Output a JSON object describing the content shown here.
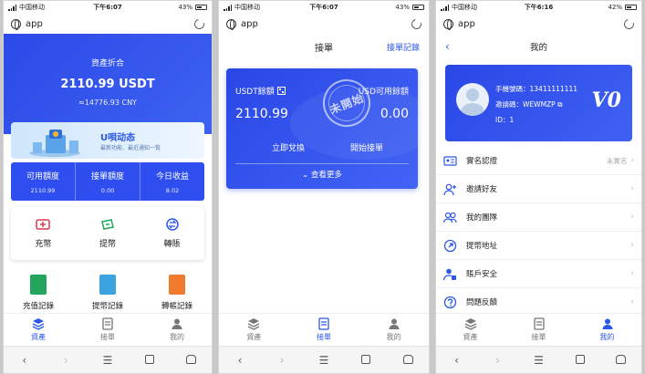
{
  "status": {
    "carrier": "中国移动",
    "s1_time": "下午6:07",
    "s2_time": "下午6:07",
    "s3_time": "下午6:16",
    "s1_battery": "43%",
    "s2_battery": "43%",
    "s3_battery": "42%"
  },
  "browser": {
    "title": "app"
  },
  "assets": {
    "label": "資產折合",
    "amount": "2110.99 USDT",
    "cny": "≈14776.93 CNY",
    "banner_title": "U唄动态",
    "banner_sub": "最新功能、最近通知一覧",
    "stats": [
      {
        "label": "可用額度",
        "value": "2110.99"
      },
      {
        "label": "接單額度",
        "value": "0.00"
      },
      {
        "label": "今日收益",
        "value": "8.02"
      }
    ],
    "actions": [
      "充幣",
      "提幣",
      "轉賬"
    ],
    "records": [
      "充值記錄",
      "提幣記錄",
      "轉帳記錄"
    ]
  },
  "order": {
    "title": "接單",
    "link": "接單記錄",
    "usdt_label": "USDT餘額",
    "usd_label": "USD可用餘額",
    "usdt_value": "2110.99",
    "usd_value": "0.00",
    "exchange": "立即兌換",
    "start": "開始接單",
    "more": "查看更多",
    "stamp": "未開始"
  },
  "mine": {
    "title": "我的",
    "phone": "手機號碼：13411111111",
    "invite": "邀請碼：WEWMZP",
    "id": "ID：1",
    "vip": "V0",
    "menu": [
      {
        "label": "實名認證",
        "value": "未實名"
      },
      {
        "label": "邀請好友",
        "value": ""
      },
      {
        "label": "我的團隊",
        "value": ""
      },
      {
        "label": "提幣地址",
        "value": ""
      },
      {
        "label": "賬戶安全",
        "value": ""
      },
      {
        "label": "問題反饋",
        "value": ""
      }
    ]
  },
  "tabs": [
    "資產",
    "接單",
    "我的"
  ],
  "colors": {
    "primary": "#2b57e8",
    "card": "#2e4ef0"
  }
}
